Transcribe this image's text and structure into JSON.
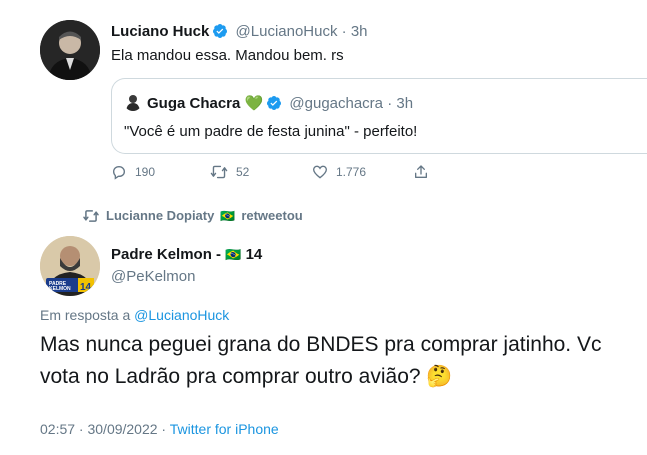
{
  "top_tweet": {
    "name": "Luciano Huck",
    "handle": "@LucianoHuck",
    "time": "· 3h",
    "text": "Ela mandou essa. Mandou bem. rs",
    "quoted": {
      "name": "Guga Chacra",
      "heart_emoji": "💚",
      "handle": "@gugachacra",
      "time": "· 3h",
      "text": "\"Você é um padre de festa junina\" - perfeito!"
    },
    "actions": {
      "replies": "190",
      "retweets": "52",
      "likes": "1.776"
    }
  },
  "retweet_banner": {
    "text": "Lucianne Dopiaty",
    "flag": "🇧🇷",
    "suffix": "retweetou"
  },
  "main_tweet": {
    "name": "Padre Kelmon -",
    "flag": "🇧🇷",
    "number": "14",
    "handle": "@PeKelmon",
    "avatar_badge": "PADRE KELMON 14",
    "reply_prefix": "Em resposta a",
    "reply_to": "@LucianoHuck",
    "text_line1": "Mas nunca peguei grana do BNDES pra comprar jatinho. Vc",
    "text_line2": "vota no Ladrão pra comprar outro avião?",
    "thinking_emoji": "🤔",
    "timestamp": "02:57 · 30/09/2022 ·",
    "source": "Twitter for iPhone"
  },
  "colors": {
    "accent": "#1b95e0",
    "verified": "#1d9bf0",
    "muted": "#657786",
    "border": "#cfd9de",
    "retweet_green": "#17bf63"
  }
}
